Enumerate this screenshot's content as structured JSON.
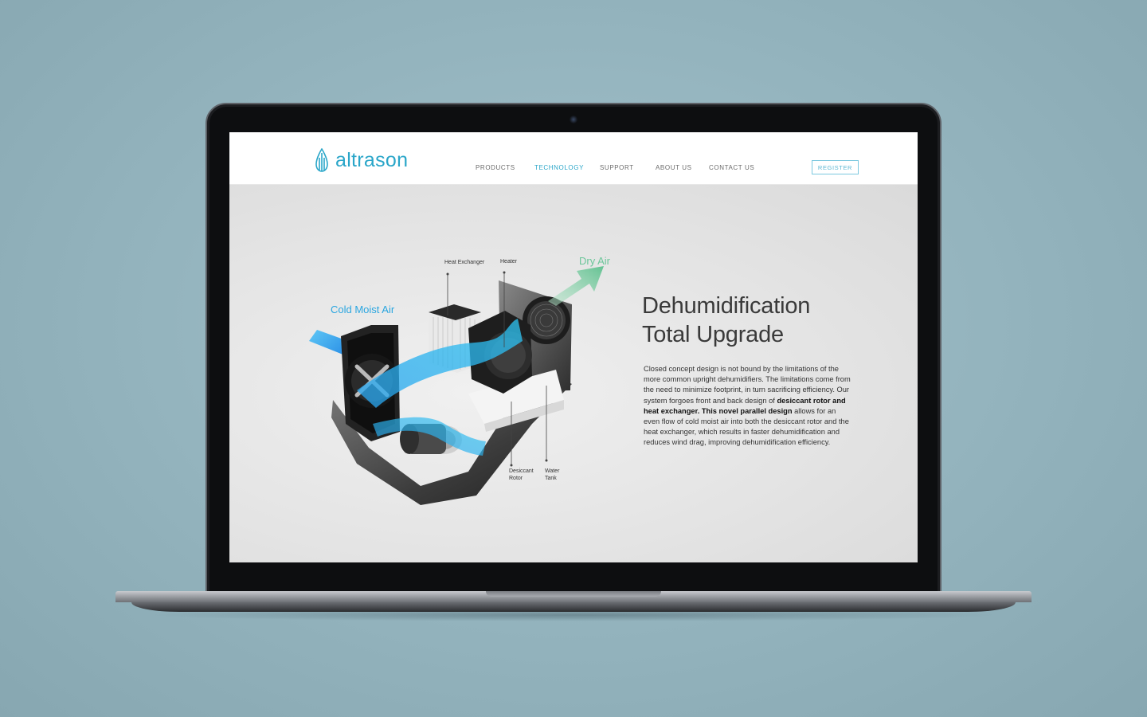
{
  "brand": {
    "name": "altrason",
    "color": "#2aa6c9"
  },
  "nav": {
    "items": [
      {
        "label": "PRODUCTS"
      },
      {
        "label": "TECHNOLOGY",
        "active": true
      },
      {
        "label": "SUPPORT"
      },
      {
        "label": "ABOUT US"
      },
      {
        "label": "CONTACT US"
      }
    ],
    "register_label": "REGISTER"
  },
  "diagram": {
    "flow_in_label": "Cold Moist Air",
    "flow_out_label": "Dry Air",
    "flow_in_color": "#2aa6e0",
    "flow_out_color": "#6cc69a",
    "parts": {
      "heat_exchanger": "Heat Exchanger",
      "heater": "Heater",
      "desiccant_rotor_line1": "Desiccant",
      "desiccant_rotor_line2": "Rotor",
      "water_tank_line1": "Water",
      "water_tank_line2": "Tank"
    }
  },
  "content": {
    "headline_line1": "Dehumidification",
    "headline_line2": "Total Upgrade",
    "body_part1": "Closed concept design is not bound by the limitations of the more common upright dehumidifiers. The limitations come from the need to minimize footprint, in turn sacrificing efficiency. Our system forgoes front and back design of ",
    "body_bold": "desiccant rotor and heat exchanger. This novel parallel design",
    "body_part2": " allows for an even flow of cold moist air into both the desiccant rotor and the heat exchanger, which results in faster dehumidification and reduces wind drag, improving dehumidification efficiency."
  }
}
